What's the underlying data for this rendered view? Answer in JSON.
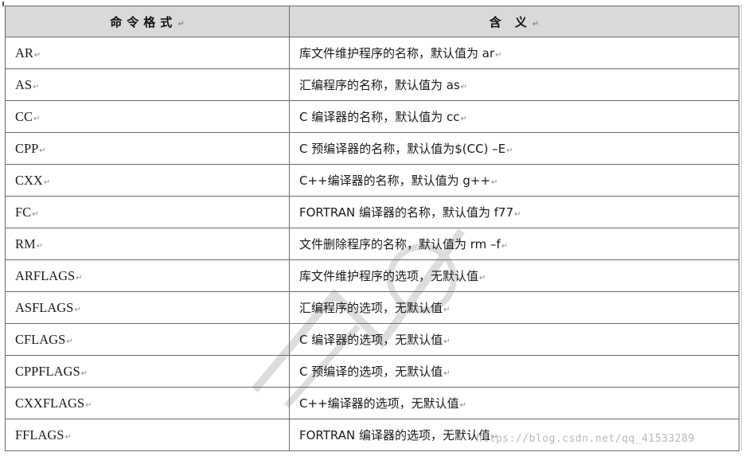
{
  "table": {
    "header": {
      "command_format": "命令格式",
      "meaning": "含 义"
    },
    "rows": [
      {
        "command": "AR",
        "meaning": "库文件维护程序的名称，默认值为 ar"
      },
      {
        "command": "AS",
        "meaning": "汇编程序的名称，默认值为 as"
      },
      {
        "command": "CC",
        "meaning": "C 编译器的名称，默认值为 cc"
      },
      {
        "command": "CPP",
        "meaning": "C 预编译器的名称，默认值为$(CC) –E"
      },
      {
        "command": "CXX",
        "meaning": "C++编译器的名称，默认值为 g++"
      },
      {
        "command": "FC",
        "meaning": "FORTRAN 编译器的名称，默认值为 f77"
      },
      {
        "command": "RM",
        "meaning": "文件删除程序的名称，默认值为 rm –f"
      },
      {
        "command": "ARFLAGS",
        "meaning": "库文件维护程序的选项，无默认值"
      },
      {
        "command": "ASFLAGS",
        "meaning": "汇编程序的选项，无默认值"
      },
      {
        "command": "CFLAGS",
        "meaning": "C 编译器的选项，无默认值"
      },
      {
        "command": "CPPFLAGS",
        "meaning": "C 预编译的选项，无默认值"
      },
      {
        "command": "CXXFLAGS",
        "meaning": "C++编译器的选项，无默认值"
      },
      {
        "command": "FFLAGS",
        "meaning": "FORTRAN 编译器的选项，无默认值"
      }
    ]
  },
  "watermark": {
    "text": "https://blog.csdn.net/qq_41533289"
  },
  "colors": {
    "header_bg": "#d9d9d9",
    "border": "#6a6a6a",
    "para_mark": "#8a8a8a"
  }
}
